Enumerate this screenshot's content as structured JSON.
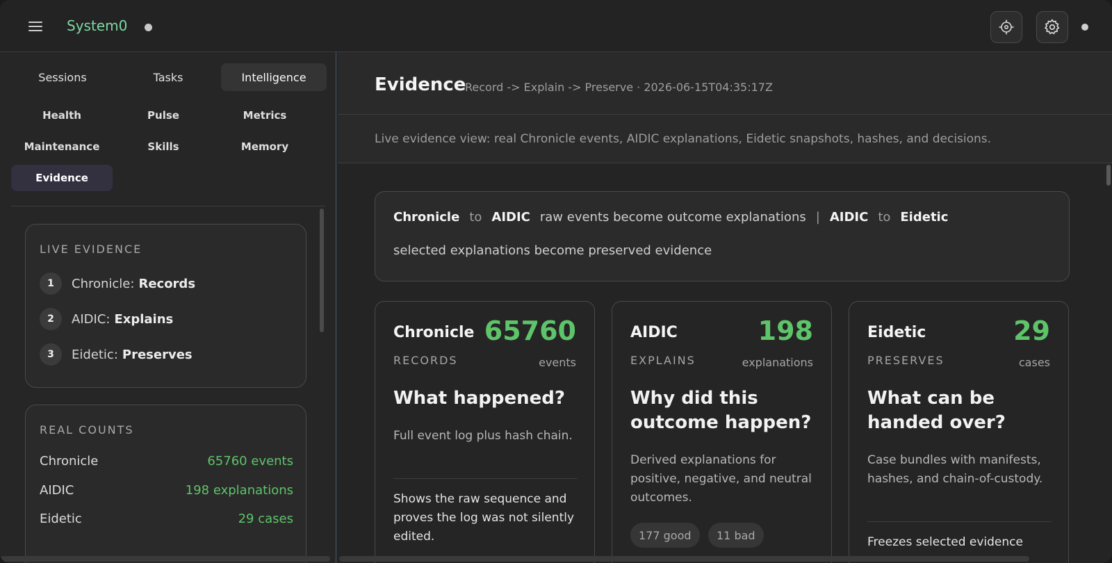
{
  "app": {
    "title": "System0"
  },
  "tabs": [
    "Sessions",
    "Tasks",
    "Intelligence"
  ],
  "subnav": [
    "Health",
    "Pulse",
    "Metrics",
    "Maintenance",
    "Skills",
    "Memory",
    "Evidence"
  ],
  "live_evidence": {
    "title": "LIVE EVIDENCE",
    "steps": [
      {
        "num": "1",
        "label": "Chronicle:",
        "value": "Records"
      },
      {
        "num": "2",
        "label": "AIDIC:",
        "value": "Explains"
      },
      {
        "num": "3",
        "label": "Eidetic:",
        "value": "Preserves"
      }
    ]
  },
  "real_counts": {
    "title": "REAL COUNTS",
    "rows": [
      {
        "label": "Chronicle",
        "value": "65760 events"
      },
      {
        "label": "AIDIC",
        "value": "198 explanations"
      },
      {
        "label": "Eidetic",
        "value": "29 cases"
      }
    ]
  },
  "main": {
    "title": "Evidence",
    "subtitle": "Record -> Explain -> Preserve · 2026-06-15T04:35:17Z",
    "description": "Live evidence view: real Chronicle events, AIDIC explanations, Eidetic snapshots, hashes, and decisions.",
    "flow": {
      "a": "Chronicle",
      "to1": "to",
      "b": "AIDIC",
      "desc1": "raw events become outcome explanations",
      "sep": "|",
      "c": "AIDIC",
      "to2": "to",
      "d": "Eidetic",
      "desc2": "selected explanations become preserved evidence"
    },
    "cards": [
      {
        "name": "Chronicle",
        "count": "65760",
        "role": "RECORDS",
        "unit": "events",
        "question": "What happened?",
        "body": "Full event log plus hash chain.",
        "extra": "Shows the raw sequence and proves the log was not silently edited."
      },
      {
        "name": "AIDIC",
        "count": "198",
        "role": "EXPLAINS",
        "unit": "explanations",
        "question": "Why did this outcome happen?",
        "body": "Derived explanations for positive, negative, and neutral outcomes.",
        "pills": [
          "177 good",
          "11 bad"
        ]
      },
      {
        "name": "Eidetic",
        "count": "29",
        "role": "PRESERVES",
        "unit": "cases",
        "question": "What can be handed over?",
        "body": "Case bundles with manifests, hashes, and chain-of-custody.",
        "extra": "Freezes selected evidence"
      }
    ]
  },
  "colors": {
    "accent_green": "#5ec46a",
    "title_green": "#7ed9a2",
    "background": "#242424"
  }
}
